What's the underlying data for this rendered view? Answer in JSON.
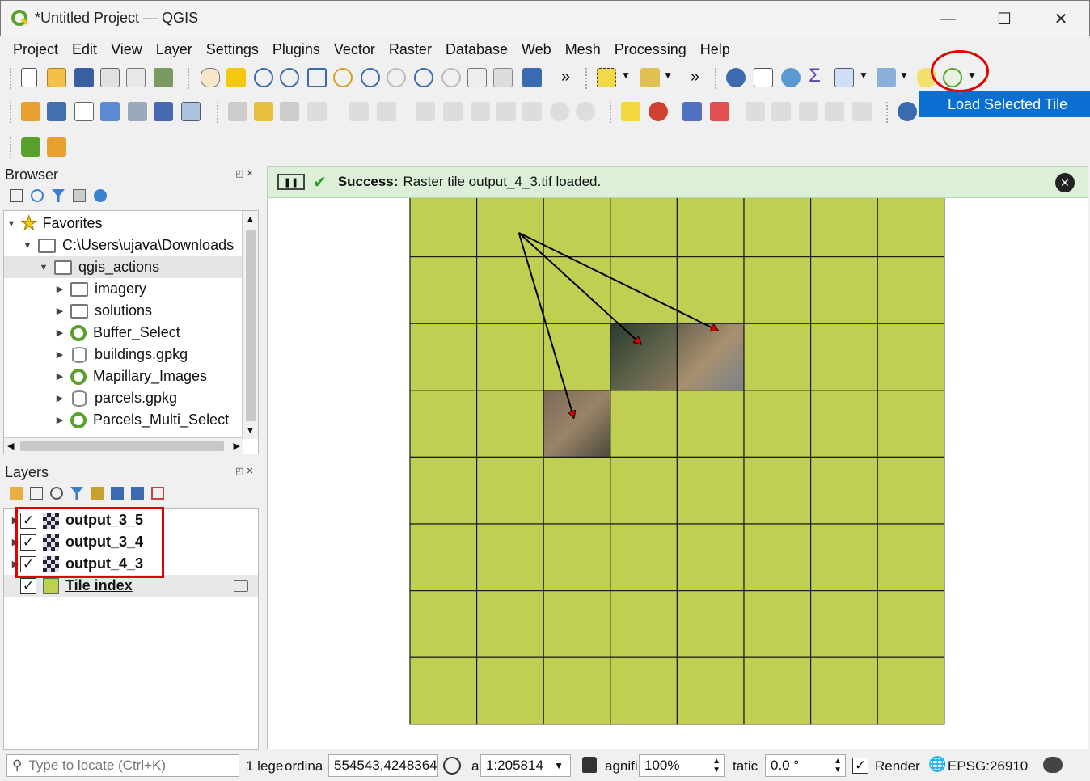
{
  "window": {
    "title": "*Untitled Project — QGIS",
    "minimize": "—",
    "maximize": "☐",
    "close": "✕"
  },
  "menu": [
    "Project",
    "Edit",
    "View",
    "Layer",
    "Settings",
    "Plugins",
    "Vector",
    "Raster",
    "Database",
    "Web",
    "Mesh",
    "Processing",
    "Help"
  ],
  "toolbar": {
    "overflow1": "»",
    "overflow2": "»",
    "highlighted_action": "Load Selected Tile"
  },
  "browser": {
    "title": "Browser",
    "items": [
      {
        "label": "Favorites",
        "indent": 0,
        "icon": "star",
        "expanded": true
      },
      {
        "label": "C:\\Users\\ujava\\Downloads",
        "indent": 1,
        "icon": "folder",
        "expanded": true
      },
      {
        "label": "qgis_actions",
        "indent": 2,
        "icon": "folder",
        "expanded": true,
        "selected": true
      },
      {
        "label": "imagery",
        "indent": 3,
        "icon": "folder"
      },
      {
        "label": "solutions",
        "indent": 3,
        "icon": "folder"
      },
      {
        "label": "Buffer_Select",
        "indent": 3,
        "icon": "qgis"
      },
      {
        "label": "buildings.gpkg",
        "indent": 3,
        "icon": "db"
      },
      {
        "label": "Mapillary_Images",
        "indent": 3,
        "icon": "qgis"
      },
      {
        "label": "parcels.gpkg",
        "indent": 3,
        "icon": "db"
      },
      {
        "label": "Parcels_Multi_Select",
        "indent": 3,
        "icon": "qgis"
      }
    ]
  },
  "layers": {
    "title": "Layers",
    "items": [
      {
        "label": "output_3_5",
        "checked": "✓",
        "type": "raster"
      },
      {
        "label": "output_3_4",
        "checked": "✓",
        "type": "raster"
      },
      {
        "label": "output_4_3",
        "checked": "✓",
        "type": "raster"
      },
      {
        "label": "Tile index",
        "checked": "✓",
        "type": "polygon"
      }
    ]
  },
  "message": {
    "prefix": "Success:",
    "text": "Raster tile output_4_3.tif loaded.",
    "pause": "❚❚",
    "check": "✔"
  },
  "map": {
    "grid_cols": 8,
    "grid_rows": 8,
    "fill_color": "#c0cf52",
    "line_color": "#1a1a1a",
    "loaded_tiles": [
      {
        "row": 2,
        "col": 3
      },
      {
        "row": 2,
        "col": 4
      },
      {
        "row": 3,
        "col": 2
      }
    ]
  },
  "status": {
    "locate_placeholder": "Type to locate (Ctrl+K)",
    "legend_label": "1 lege",
    "coord_label": "ordina",
    "coordinate": "554543,4248364",
    "scale_label": "a",
    "scale": "1:205814",
    "magnifier_label": "agnifi",
    "magnifier": "100%",
    "rotation_label": "tatic",
    "rotation": "0.0 °",
    "render_label": "Render",
    "render_checked": "✓",
    "crs": "EPSG:26910"
  },
  "colors": {
    "accent": "#0b6fd2",
    "highlight_red": "#e00000",
    "success_bg": "#dcf0d8",
    "qgis_green": "#5aa02c"
  }
}
